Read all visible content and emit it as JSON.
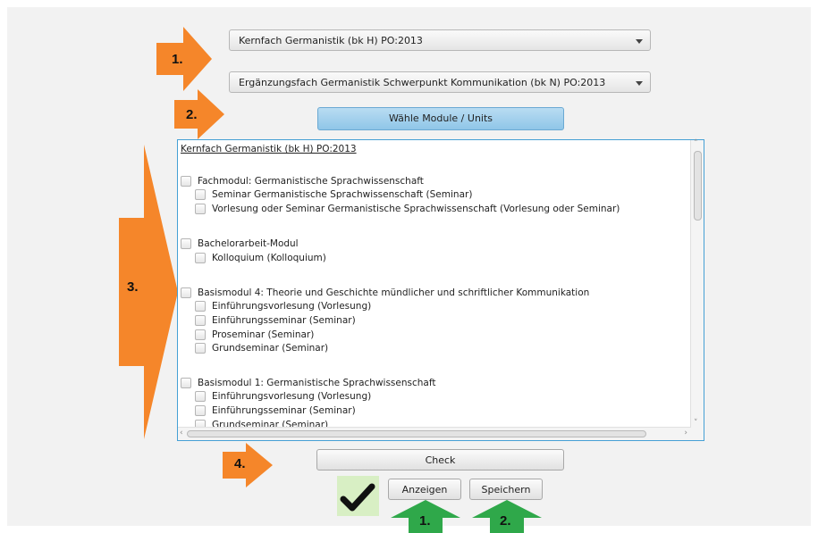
{
  "selects": {
    "major": "Kernfach Germanistik (bk H) PO:2013",
    "minor": "Ergänzungsfach Germanistik Schwerpunkt Kommunikation (bk N) PO:2013"
  },
  "buttons": {
    "choose_modules": "Wähle Module / Units",
    "check": "Check",
    "show": "Anzeigen",
    "save": "Speichern"
  },
  "tree": {
    "root": "Kernfach Germanistik (bk H) PO:2013",
    "modules": [
      {
        "label": "Fachmodul: Germanistische Sprachwissenschaft",
        "units": [
          "Seminar Germanistische Sprachwissenschaft (Seminar)",
          "Vorlesung oder Seminar Germanistische Sprachwissenschaft (Vorlesung oder Seminar)"
        ]
      },
      {
        "label": "Bachelorarbeit-Modul",
        "units": [
          "Kolloquium (Kolloquium)"
        ]
      },
      {
        "label": "Basismodul 4: Theorie und Geschichte mündlicher und schriftlicher Kommunikation",
        "units": [
          "Einführungsvorlesung (Vorlesung)",
          "Einführungsseminar (Seminar)",
          "Proseminar (Seminar)",
          "Grundseminar (Seminar)"
        ]
      },
      {
        "label": "Basismodul 1: Germanistische Sprachwissenschaft",
        "units": [
          "Einführungsvorlesung (Vorlesung)",
          "Einführungsseminar (Seminar)",
          "Grundseminar (Seminar)"
        ]
      }
    ]
  },
  "annotations": {
    "step1": "1.",
    "step2": "2.",
    "step3": "3.",
    "step4": "4.",
    "bottom1": "1.",
    "bottom2": "2."
  },
  "colors": {
    "orange_arrow": "#f5862a",
    "green_arrow": "#2fa84a",
    "panel_border": "#45a0d5",
    "primary_button": "#9fcdea",
    "check_bg": "#d8efc4"
  },
  "icons": {
    "dropdown": "chevron-down-icon",
    "check": "checkmark-icon"
  }
}
